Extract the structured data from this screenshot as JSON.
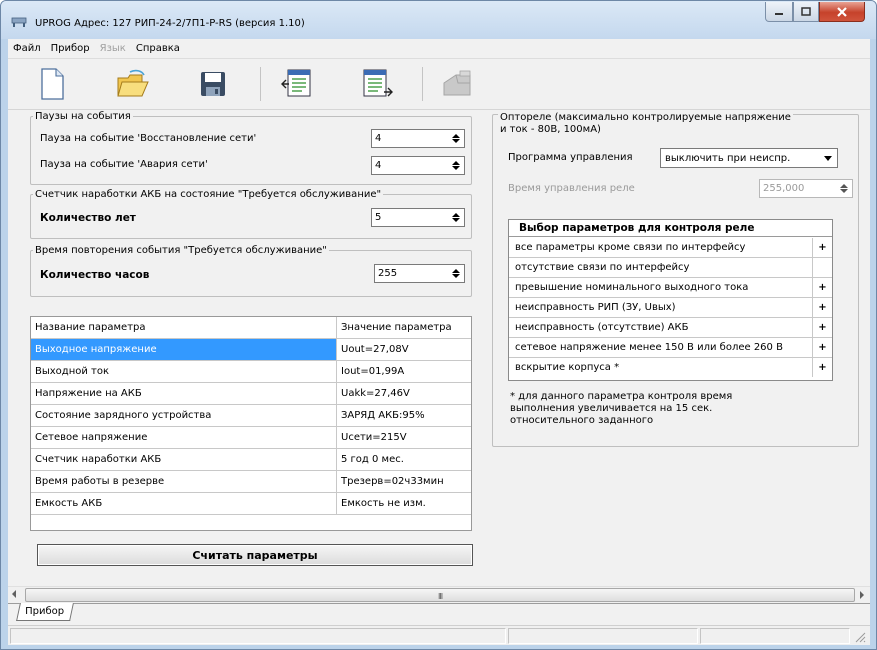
{
  "window": {
    "title": "UPROG  Адрес: 127  РИП-24-2/7П1-P-RS (версия  1.10)",
    "buttons": {
      "minimize": "–",
      "maximize": "□",
      "close": "✕"
    }
  },
  "menu": [
    {
      "label": "Файл",
      "disabled": false
    },
    {
      "label": "Прибор",
      "disabled": false
    },
    {
      "label": "Язык",
      "disabled": true
    },
    {
      "label": "Справка",
      "disabled": false
    }
  ],
  "toolbar": [
    "new-document-icon",
    "open-folder-icon",
    "save-floppy-icon",
    "read-device-icon",
    "write-device-icon",
    "device-disabled-icon"
  ],
  "pauses": {
    "legend": "Паузы на события",
    "restore_label": "Пауза на событие 'Восстановление сети'",
    "restore_value": "4",
    "fault_label": "Пауза на событие 'Авария сети'",
    "fault_value": "4"
  },
  "counter": {
    "legend": "Счетчик наработки АКБ на состояние \"Требуется обслуживание\"",
    "label": "Количество лет",
    "value": "5"
  },
  "repeat": {
    "legend": "Время повторения события \"Требуется обслуживание\"",
    "label": "Количество часов",
    "value": "255"
  },
  "params_table": {
    "headers": [
      "Название параметра",
      "Значение параметра"
    ],
    "rows": [
      {
        "name": "Выходное напряжение",
        "value": "Uout=27,08V",
        "selected": true
      },
      {
        "name": "Выходной ток",
        "value": "Iout=01,99A",
        "selected": false
      },
      {
        "name": "Напряжение на АКБ",
        "value": "Uakk=27,46V",
        "selected": false
      },
      {
        "name": "Состояние зарядного устройства",
        "value": "ЗАРЯД АКБ:95%",
        "selected": false
      },
      {
        "name": "Сетевое напряжение",
        "value": "Uсети=215V",
        "selected": false
      },
      {
        "name": "Счетчик наработки АКБ",
        "value": "5 год 0 мес.",
        "selected": false
      },
      {
        "name": "Время работы в резерве",
        "value": "Трезерв=02ч33мин",
        "selected": false
      },
      {
        "name": "Емкость АКБ",
        "value": "Емкость не изм.",
        "selected": false
      }
    ]
  },
  "read_button": "Считать параметры",
  "relay": {
    "legend_line1": "Оптореле (максимально контролируемые напряжение",
    "legend_line2": "и ток - 80В, 100мА)",
    "program_label": "Программа управления",
    "program_value": "выключить при неиспр.",
    "time_label": "Время управления реле",
    "time_value": "255,000",
    "table_title": "Выбор параметров для контроля реле",
    "rows": [
      {
        "name": "все параметры кроме связи по интерфейсу",
        "mark": "+"
      },
      {
        "name": "отсутствие связи по интерфейсу",
        "mark": ""
      },
      {
        "name": "превышение номинального выходного тока",
        "mark": "+"
      },
      {
        "name": "неисправность РИП (ЗУ, Uвых)",
        "mark": "+"
      },
      {
        "name": "неисправность (отсутствие) АКБ",
        "mark": "+"
      },
      {
        "name": "сетевое напряжение менее 150 В или более 260 В",
        "mark": "+"
      },
      {
        "name": "вскрытие корпуса  *",
        "mark": "+"
      }
    ],
    "note_line1": "* для данного параметра контроля  время",
    "note_line2": "выполнения увеличивается на 15 сек.",
    "note_line3": "относительного заданного"
  },
  "scrollbar": {
    "grip": "III"
  },
  "tabs": [
    {
      "label": "Прибор"
    }
  ]
}
